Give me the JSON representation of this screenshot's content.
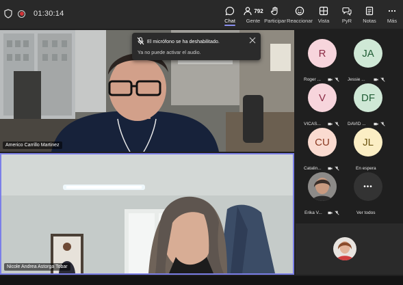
{
  "meeting": {
    "timer": "01:30:14",
    "people_count": "792"
  },
  "toolbar": {
    "items": [
      {
        "label": "Chat",
        "icon": "chat-icon"
      },
      {
        "label": "Gente",
        "icon": "people-icon"
      },
      {
        "label": "Participar",
        "icon": "raise-hand-icon"
      },
      {
        "label": "Reaccionar",
        "icon": "reaction-icon"
      },
      {
        "label": "Vista",
        "icon": "view-icon"
      },
      {
        "label": "PyR",
        "icon": "qa-icon"
      },
      {
        "label": "Notas",
        "icon": "notes-icon"
      },
      {
        "label": "Más",
        "icon": "more-icon"
      }
    ]
  },
  "notification": {
    "title": "El micrófono se ha deshabilitado.",
    "body": "Ya no puede activar el audio."
  },
  "videos": [
    {
      "name": "Americo Carrillo Martinez"
    },
    {
      "name": "Nicole Andrea Astorga Tobar"
    }
  ],
  "participants": [
    {
      "initials": "R",
      "name": "Roger ...",
      "bg": "#f7d5dc",
      "fg": "#8a2a44"
    },
    {
      "initials": "JA",
      "name": "Jessie ...",
      "bg": "#cfe8d6",
      "fg": "#1f5c34"
    },
    {
      "initials": "V",
      "name": "VICAS...",
      "bg": "#f7d5dc",
      "fg": "#8a2a44"
    },
    {
      "initials": "DF",
      "name": "DAVID ...",
      "bg": "#cfe8d6",
      "fg": "#1f5c34"
    },
    {
      "initials": "CU",
      "name": "Catalin...",
      "bg": "#fadbd0",
      "fg": "#8a3a22"
    },
    {
      "initials": "JL",
      "name": "En espera",
      "bg": "#fbeec4",
      "fg": "#6b5410"
    },
    {
      "initials": "",
      "name": "Erika V...",
      "bg": "#5a5a5a",
      "fg": "#fff"
    },
    {
      "initials": "•••",
      "name": "Ver todos",
      "bg": "#333333",
      "fg": "#fff"
    }
  ],
  "colors": {
    "accent": "#8a8ff0",
    "record": "#d13438"
  }
}
